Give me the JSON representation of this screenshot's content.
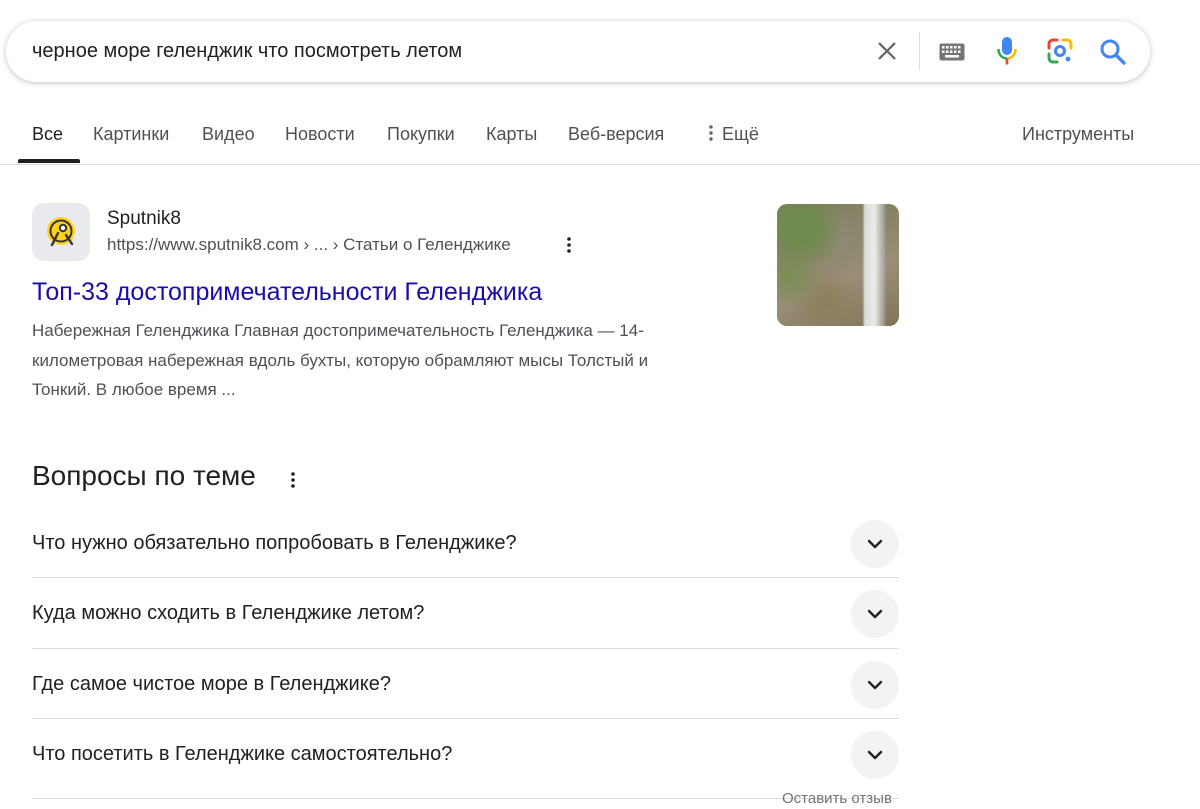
{
  "search": {
    "query": "черное море геленджик что посмотреть летом"
  },
  "tabs": [
    {
      "label": "Все",
      "active": true
    },
    {
      "label": "Картинки"
    },
    {
      "label": "Видео"
    },
    {
      "label": "Новости"
    },
    {
      "label": "Покупки"
    },
    {
      "label": "Карты"
    },
    {
      "label": "Веб-версия"
    },
    {
      "label": "Ещё",
      "icon": "more-vert-icon"
    }
  ],
  "tools_label": "Инструменты",
  "result": {
    "site_name": "Sputnik8",
    "url": "https://www.sputnik8.com › ... › Статьи о Геленджике",
    "title": "Топ-33 достопримечательности Геленджика",
    "snippet_lines": [
      "Набережная Геленджика Главная достопримечательность Геленджика — 14-",
      "километровая набережная вдоль бухты, которую обрамляют мысы Толстый и",
      "Тонкий. В любое время ..."
    ],
    "thumbnail": "waterfall-image"
  },
  "questions": {
    "heading": "Вопросы по теме",
    "items": [
      "Что нужно обязательно попробовать в Геленджике?",
      "Куда можно сходить в Геленджике летом?",
      "Где самое чистое море в Геленджике?",
      "Что посетить в Геленджике самостоятельно?"
    ],
    "feedback": "Оставить отзыв"
  },
  "colors": {
    "link": "#1a0dab",
    "text": "#202124",
    "secondary_text": "#4d5156",
    "search_blue": "#4285f4"
  }
}
